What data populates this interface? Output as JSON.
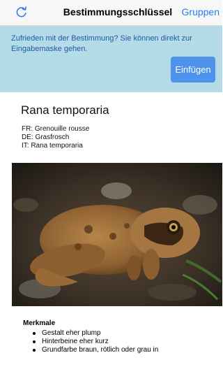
{
  "navbar": {
    "refresh_icon": "refresh-icon",
    "title": "Bestimmungsschlüssel",
    "right_link": "Gruppen",
    "accent_color": "#2f7cf6"
  },
  "banner": {
    "message": "Zufrieden mit der Bestimmung? Sie können direkt zur Eingabemaske gehen.",
    "button_label": "Einfügen",
    "background_color": "#b4dbe7"
  },
  "species": {
    "title": "Rana temporaria",
    "names": [
      "FR: Grenouille rousse",
      "DE: Grasfrosch",
      "IT: Rana temporaria"
    ]
  },
  "features": {
    "heading": "Merkmale",
    "items": [
      "Gestalt eher plump",
      "Hinterbeine eher kurz",
      "Grundfarbe braun, rötlich oder grau in"
    ]
  }
}
